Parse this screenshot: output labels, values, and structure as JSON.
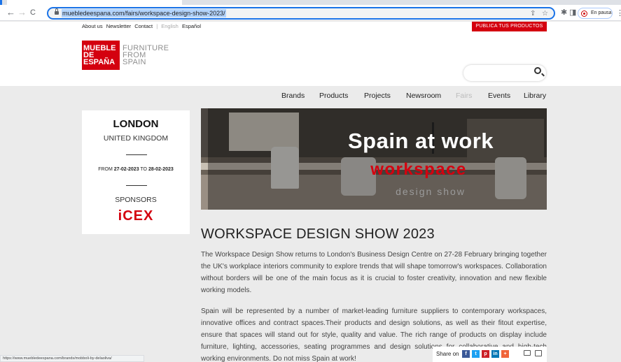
{
  "browser": {
    "url": "muebledeespana.com/fairs/workspace-design-show-2023/",
    "nav": {
      "back": "←",
      "forward": "→",
      "reload": "C"
    },
    "profile_status": "En pausa",
    "status_url": "https://www.muebledeespana.com/brands/mobboli-by-delaoliva/",
    "colors": {
      "omnibox_focus": "#1a73e8",
      "selection": "#b3d4fc"
    }
  },
  "site": {
    "toplinks": [
      "About us",
      "Newsletter",
      "Contact",
      "|",
      "English",
      "Español"
    ],
    "publish_button": "PUBLICA TUS PRODUCTOS",
    "logo": {
      "red_lines": [
        "MUEBLE",
        "DE",
        "ESPAÑA"
      ],
      "gray_lines": [
        "FURNITURE",
        "FROM",
        "SPAIN"
      ]
    },
    "nav": [
      "Brands",
      "Products",
      "Projects",
      "Newsroom",
      "Fairs",
      "Events",
      "Library"
    ],
    "brand_color": "#d4000f"
  },
  "event": {
    "city": "LONDON",
    "country": "UNITED KINGDOM",
    "from_label": "FROM ",
    "from_date": "27-02-2023",
    "to_label": " TO ",
    "to_date": "28-02-2023",
    "sponsors_label": "SPONSORS",
    "sponsor": "iCEX"
  },
  "hero": {
    "line1": "Spain at work",
    "line2": "workspace",
    "line3": "design show"
  },
  "article": {
    "title": "WORKSPACE DESIGN SHOW 2023",
    "paragraph1": "The Workspace Design Show returns to London's Business Design Centre on 27-28 February bringing together the UK's workplace interiors community to explore trends that will shape tomorrow's workspaces. Collaboration without borders will be one of the main focus as it is crucial to foster creativity, innovation and new flexible working models.",
    "paragraph2": "Spain will be represented by a number of market-leading furniture suppliers to contemporary  workspaces, innovative offices and contract spaces.Their products and design solutions, as well as their fitout expertise, ensure that spaces will stand out for style, quality and value. The rich range of products on display include furniture, lighting, accessories, seating programmes and design solutions for collaborative and high-tech working environments. Do not miss Spain at work!"
  },
  "share": {
    "label": "Share on",
    "buttons": [
      {
        "icon": "facebook-icon",
        "glyph": "f",
        "color": "#3b5998"
      },
      {
        "icon": "twitter-icon",
        "glyph": "t",
        "color": "#1da1f2"
      },
      {
        "icon": "pinterest-icon",
        "glyph": "p",
        "color": "#cb2027"
      },
      {
        "icon": "linkedin-icon",
        "glyph": "in",
        "color": "#0077b5"
      },
      {
        "icon": "plus-icon",
        "glyph": "+",
        "color": "#f0653a"
      }
    ]
  }
}
